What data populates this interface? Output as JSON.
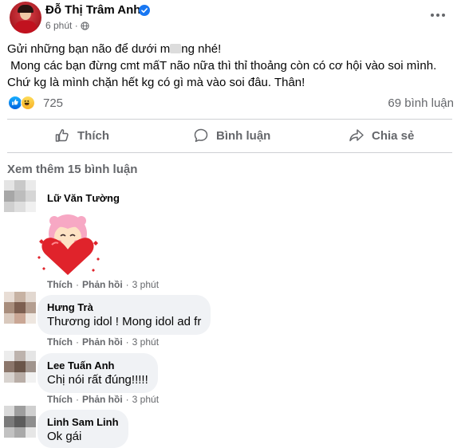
{
  "post": {
    "author": "Đỗ Thị Trâm Anh",
    "time": "6 phút ·",
    "text_lines": [
      "Gửi những bạn não để dưới m",
      "ng nhé!",
      " Mong các bạn đừng cmt mấT não nữa thì thỉ thoảng còn có cơ hội vào soi mình.",
      "Chứ kg là mình chặn hết kg có gì mà vào soi đâu. Thân!"
    ],
    "reaction_count": "725",
    "comment_count": "69 bình luận"
  },
  "actions": {
    "like": "Thích",
    "comment": "Bình luận",
    "share": "Chia sẻ"
  },
  "see_more": "Xem thêm 15 bình luận",
  "comments": [
    {
      "name": "Lữ Văn Tường",
      "text": "",
      "like": "Thích",
      "reply": "Phản hồi",
      "time": "3 phút"
    },
    {
      "name": "Hưng Trà",
      "text": "Thương idol ! Mong idol ad fr",
      "like": "Thích",
      "reply": "Phản hồi",
      "time": "3 phút"
    },
    {
      "name": "Lee Tuấn Anh",
      "text": "Chị nói rất đúng!!!!!",
      "like": "Thích",
      "reply": "Phản hồi",
      "time": "3 phút"
    },
    {
      "name": "Linh Sam Linh",
      "text": "Ok gái"
    }
  ],
  "colors": {
    "secondary_text": "#65676b",
    "bubble_bg": "#f0f2f5",
    "verified_blue": "#1877f2",
    "sticker_red": "#e0232b",
    "sticker_pink": "#f7a8c4"
  }
}
